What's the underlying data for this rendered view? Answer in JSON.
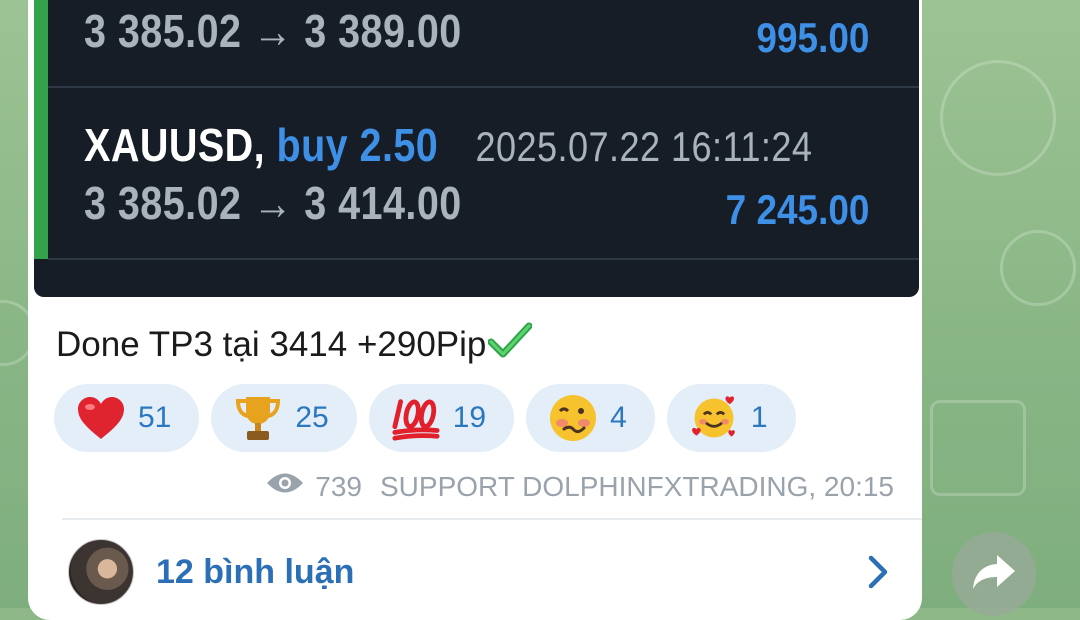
{
  "trades": [
    {
      "prices": "3 385.02 → 3 389.00",
      "profit": "995.00"
    },
    {
      "symbol": "XAUUSD,",
      "side": "buy 2.50",
      "timestamp": "2025.07.22 16:11:24",
      "prices": "3 385.02 → 3 414.00",
      "profit": "7 245.00"
    }
  ],
  "message": {
    "text": "Done TP3 tại 3414 +290Pip",
    "check_icon": "check-mark-icon"
  },
  "reactions": [
    {
      "icon": "heart-icon",
      "count": "51"
    },
    {
      "icon": "trophy-icon",
      "count": "25"
    },
    {
      "icon": "hundred-points-icon",
      "count": "19"
    },
    {
      "icon": "woozy-face-icon",
      "count": "4"
    },
    {
      "icon": "smiling-face-with-hearts-icon",
      "count": "1"
    }
  ],
  "meta": {
    "views": "739",
    "author_time": "SUPPORT DOLPHINFXTRADING, 20:15"
  },
  "comments": {
    "label": "12 bình luận"
  },
  "colors": {
    "accent_green": "#34a24a",
    "link_blue": "#2b6fb6",
    "profit_blue": "#3e8fe6",
    "panel_bg": "#161d26"
  }
}
